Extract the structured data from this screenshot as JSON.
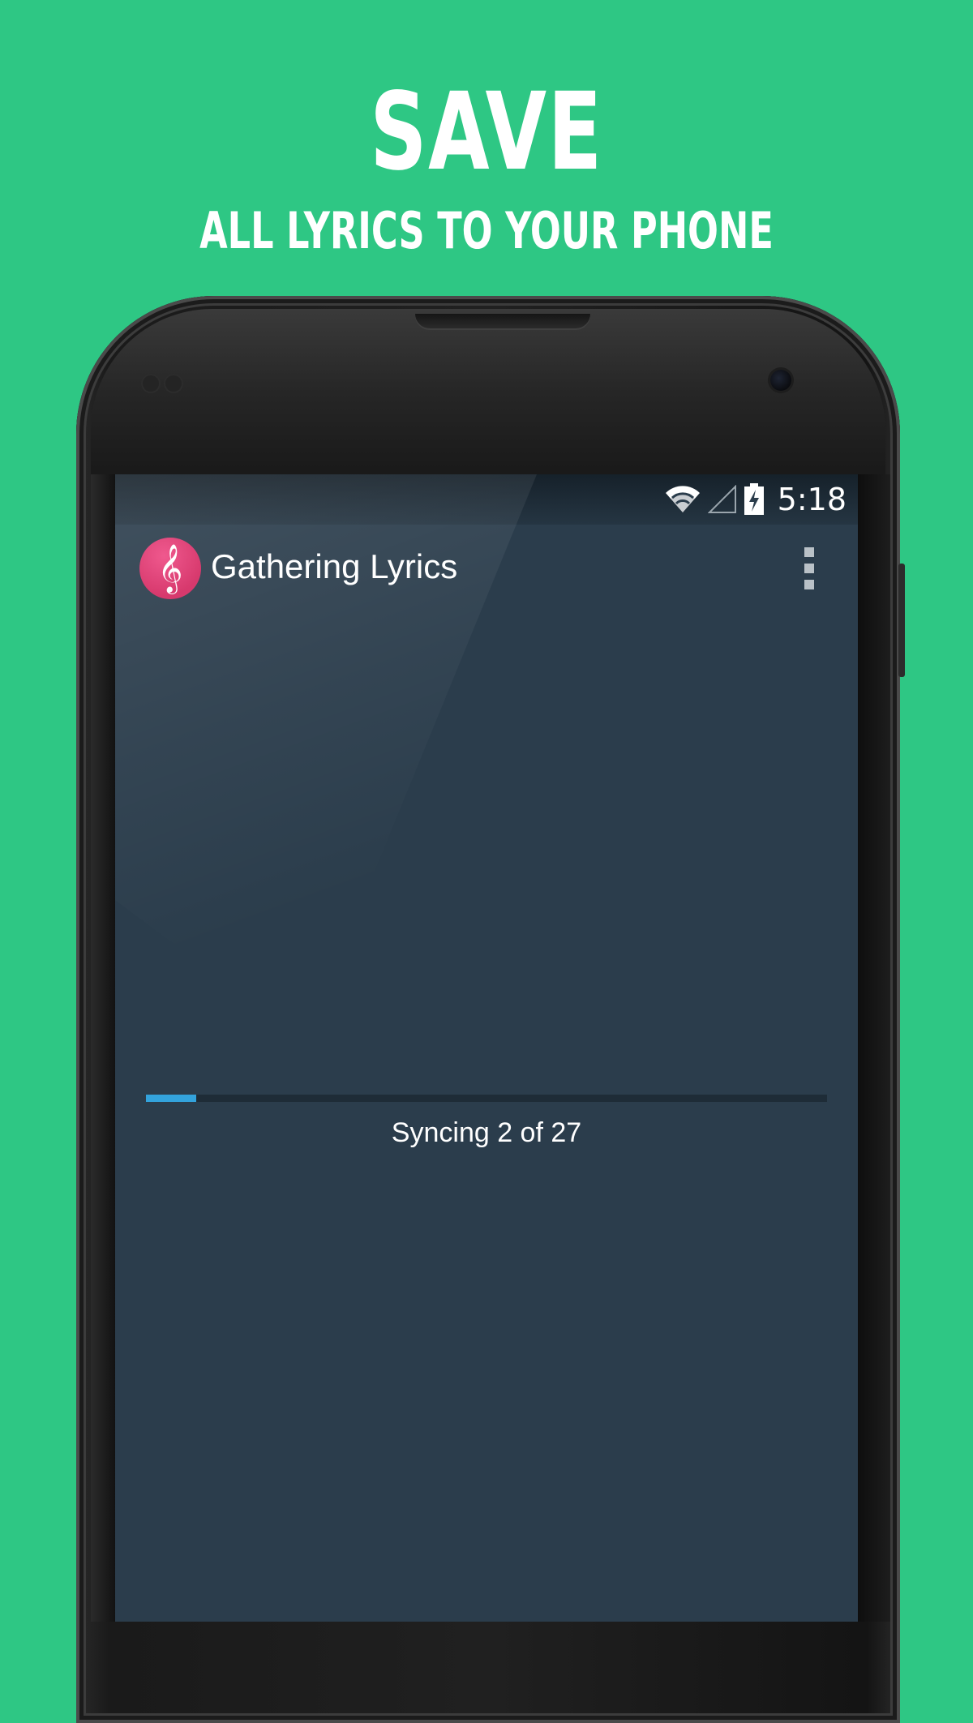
{
  "promo": {
    "headline": "SAVE",
    "subline": "ALL LYRICS TO YOUR PHONE",
    "background_color": "#2ec784"
  },
  "status_bar": {
    "time": "5:18",
    "icons": [
      "wifi-icon",
      "cell-signal-icon",
      "battery-charging-icon"
    ]
  },
  "action_bar": {
    "app_icon": "treble-clef-icon",
    "app_icon_glyph": "𝄞",
    "app_icon_color": "#e03a72",
    "title": "Gathering Lyrics",
    "overflow_icon": "overflow-menu-icon"
  },
  "sync": {
    "current": 2,
    "total": 27,
    "status_text": "Syncing 2 of 27",
    "progress_fraction": 0.074,
    "progress_color": "#33a3dc"
  }
}
